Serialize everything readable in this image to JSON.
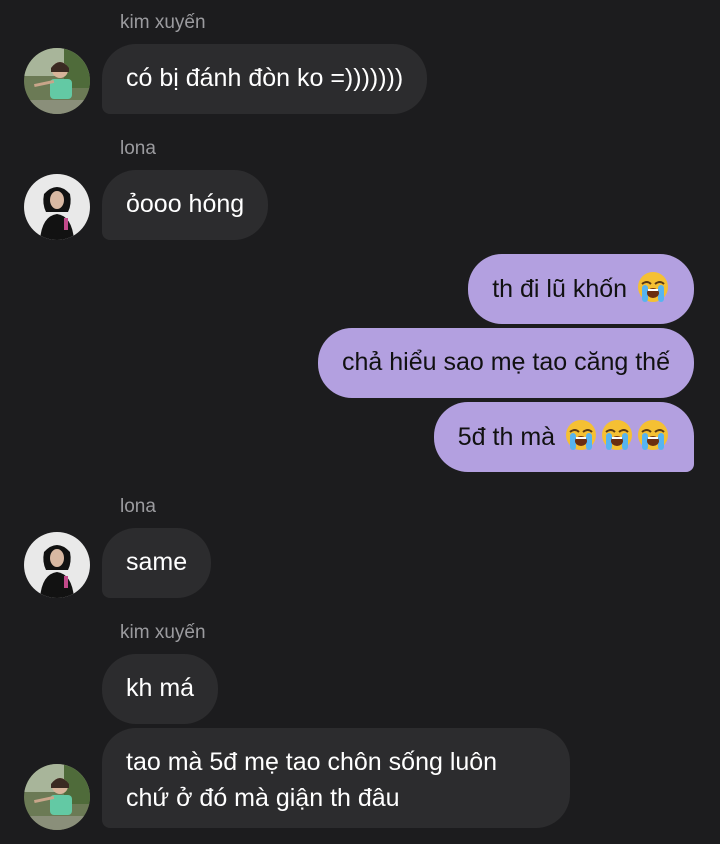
{
  "thread": {
    "messages": [
      {
        "sender": "kim xuyến",
        "text": "có bị đánh đòn ko =)))))))"
      },
      {
        "sender": "lona",
        "text": "ỏooo hóng"
      },
      {
        "text": "th đi lũ khốn",
        "emoji": "loudly-crying-face"
      },
      {
        "text": "chả hiểu sao mẹ tao căng thế"
      },
      {
        "text": "5đ th mà",
        "emoji": "loudly-crying-face"
      },
      {
        "sender": "lona",
        "text": "same"
      },
      {
        "sender": "kim xuyến",
        "text": "kh má"
      },
      {
        "line1": "tao mà 5đ mẹ tao chôn sống luôn",
        "line2": "chứ ở đó mà giận th đâu"
      }
    ]
  },
  "colors": {
    "background": "#1c1c1e",
    "incoming_bubble": "#2c2c2e",
    "outgoing_bubble": "#b3a0e0",
    "sender_label": "#9b9b9f"
  }
}
